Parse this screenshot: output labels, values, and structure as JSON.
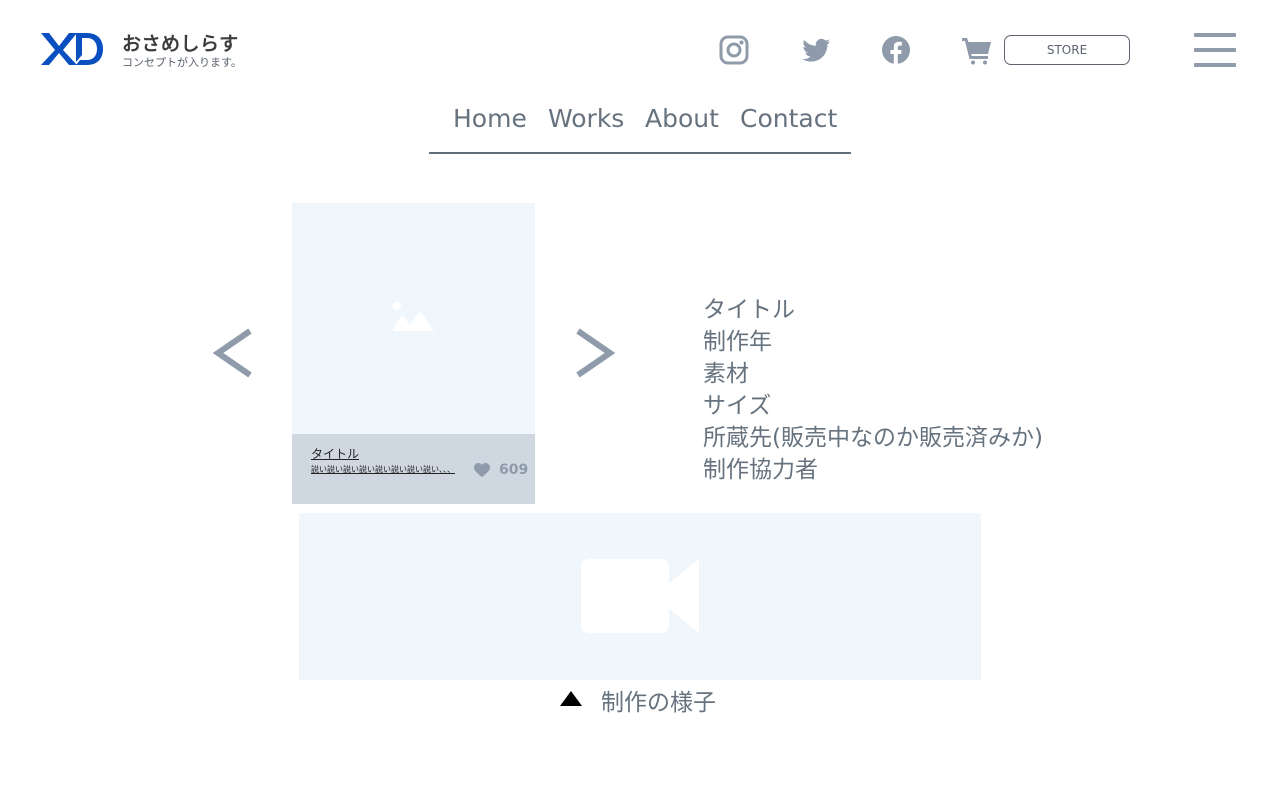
{
  "header": {
    "logo": "XD",
    "site_name": "おさめしらす",
    "concept": "コンセプトが入ります。",
    "social": [
      {
        "name": "instagram",
        "icon": "instagram-icon"
      },
      {
        "name": "twitter",
        "icon": "twitter-icon"
      },
      {
        "name": "facebook",
        "icon": "facebook-icon"
      }
    ],
    "cart_icon": "cart-icon",
    "store_label": "STORE",
    "menu_icon": "hamburger-menu-icon"
  },
  "nav": {
    "items": [
      "Home",
      "Works",
      "About",
      "Contact"
    ]
  },
  "slider": {
    "prev_icon": "chevron-left-icon",
    "next_icon": "chevron-right-icon",
    "card": {
      "image_icon": "image-placeholder-icon",
      "title": "タイトル",
      "description": "説い説い説い説い説い説い説い説い、、、",
      "likes": "609",
      "like_icon": "heart-icon"
    }
  },
  "details": {
    "lines": [
      "タイトル",
      "制作年",
      "素材",
      "サイズ",
      "所蔵先(販売中なのか販売済みか)",
      "制作協力者"
    ]
  },
  "video": {
    "icon": "video-camera-icon",
    "toggle_icon": "triangle-up-icon",
    "caption": "制作の様子"
  },
  "colors": {
    "icon_gray": "#8f9aab",
    "text_gray": "#66737f",
    "logo_blue": "#0a4fbf",
    "placeholder_bg": "#eff6fc",
    "card_footer_bg": "#cfd7e0"
  }
}
